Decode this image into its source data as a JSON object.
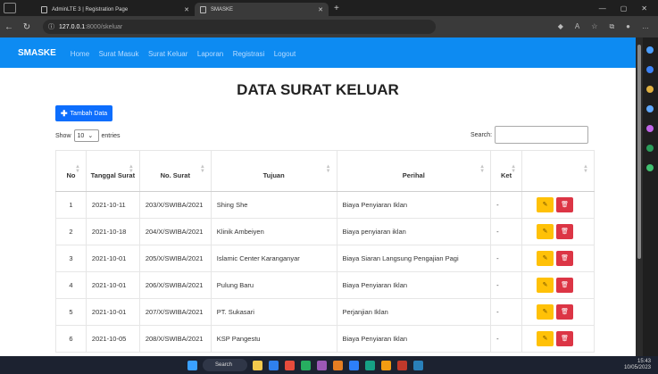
{
  "browser": {
    "tabs": [
      {
        "label": "AdminLTE 3 | Registration Page"
      },
      {
        "label": "SMASKE"
      }
    ],
    "url_host": "127.0.0.1",
    "url_path": ":8000/skeluar"
  },
  "nav": {
    "brand": "SMASKE",
    "items": [
      "Home",
      "Surat Masuk",
      "Surat Keluar",
      "Laporan",
      "Registrasi",
      "Logout"
    ]
  },
  "page": {
    "title": "DATA SURAT KELUAR",
    "add_button": "Tambah Data",
    "show_label": "Show",
    "show_value": "10",
    "entries_label": "entries",
    "search_label": "Search:"
  },
  "table": {
    "headers": [
      "No",
      "Tanggal Surat",
      "No. Surat",
      "Tujuan",
      "Perihal",
      "Ket",
      ""
    ],
    "rows": [
      {
        "no": "1",
        "tanggal": "2021-10-11",
        "nomor": "203/X/SWIBA/2021",
        "tujuan": "Shing She",
        "perihal": "Biaya Penyiaran Iklan",
        "ket": "-"
      },
      {
        "no": "2",
        "tanggal": "2021-10-18",
        "nomor": "204/X/SWIBA/2021",
        "tujuan": "Klinik Ambeiyen",
        "perihal": "Biaya penyiaran iklan",
        "ket": "-"
      },
      {
        "no": "3",
        "tanggal": "2021-10-01",
        "nomor": "205/X/SWIBA/2021",
        "tujuan": "Islamic Center Karanganyar",
        "perihal": "Biaya Siaran Langsung Pengajian Pagi",
        "ket": "-"
      },
      {
        "no": "4",
        "tanggal": "2021-10-01",
        "nomor": "206/X/SWIBA/2021",
        "tujuan": "Pulung Baru",
        "perihal": "Biaya Penyiaran Iklan",
        "ket": "-"
      },
      {
        "no": "5",
        "tanggal": "2021-10-01",
        "nomor": "207/X/SWIBA/2021",
        "tujuan": "PT. Sukasari",
        "perihal": "Perjanjian Iklan",
        "ket": "-"
      },
      {
        "no": "6",
        "tanggal": "2021-10-05",
        "nomor": "208/X/SWIBA/2021",
        "tujuan": "KSP Pangestu",
        "perihal": "Biaya Penyiaran Iklan",
        "ket": "-"
      }
    ]
  },
  "taskbar": {
    "search": "Search",
    "time": "15:43",
    "date": "10/05/2023"
  },
  "colors": {
    "navbar": "#0d8bf2",
    "primary": "#0d6efd",
    "warning": "#ffc107",
    "danger": "#dc3545"
  }
}
